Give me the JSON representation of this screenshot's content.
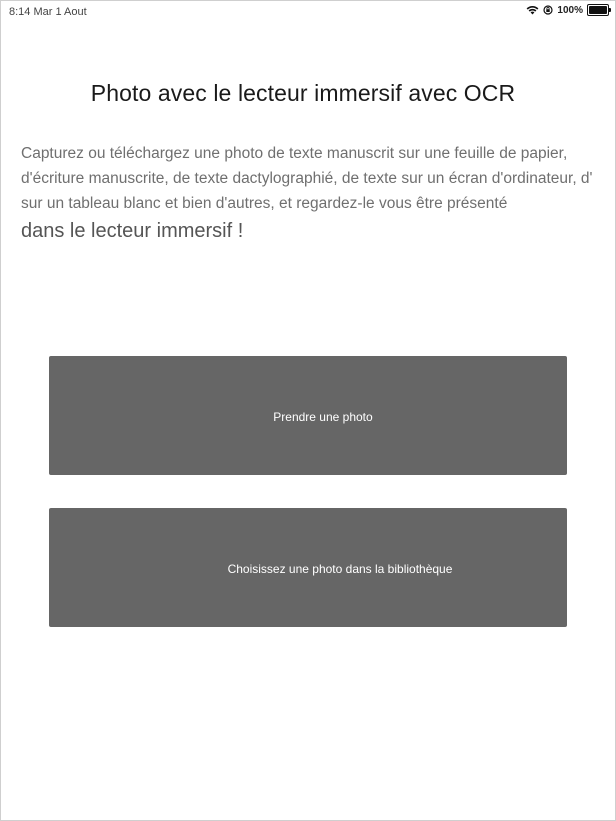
{
  "status_bar": {
    "time_date": "8:14 Mar 1 Aout",
    "battery_text": "100%",
    "battery_level": 1.0,
    "icons": [
      "wifi-icon",
      "orientation-lock-icon",
      "battery-icon"
    ]
  },
  "header": {
    "title": "Photo avec le lecteur immersif avec OCR"
  },
  "description": {
    "line1": "Capturez ou téléchargez une photo de texte manuscrit sur une feuille de papier,",
    "line2": "d'écriture manuscrite, de texte dactylographié, de texte sur un écran d'ordinateur, d'",
    "line3": "sur un tableau blanc et bien d'autres, et regardez-le vous être présenté",
    "emphasis": "dans le lecteur immersif !"
  },
  "actions": {
    "take_photo_label": "Prendre une photo",
    "choose_library_label": "Choisissez une photo dans la bibliothèque"
  },
  "colors": {
    "button_bg": "#666666",
    "button_text": "#ffffff",
    "title_text": "#1a1a1a",
    "body_text": "#6f6f6f"
  }
}
